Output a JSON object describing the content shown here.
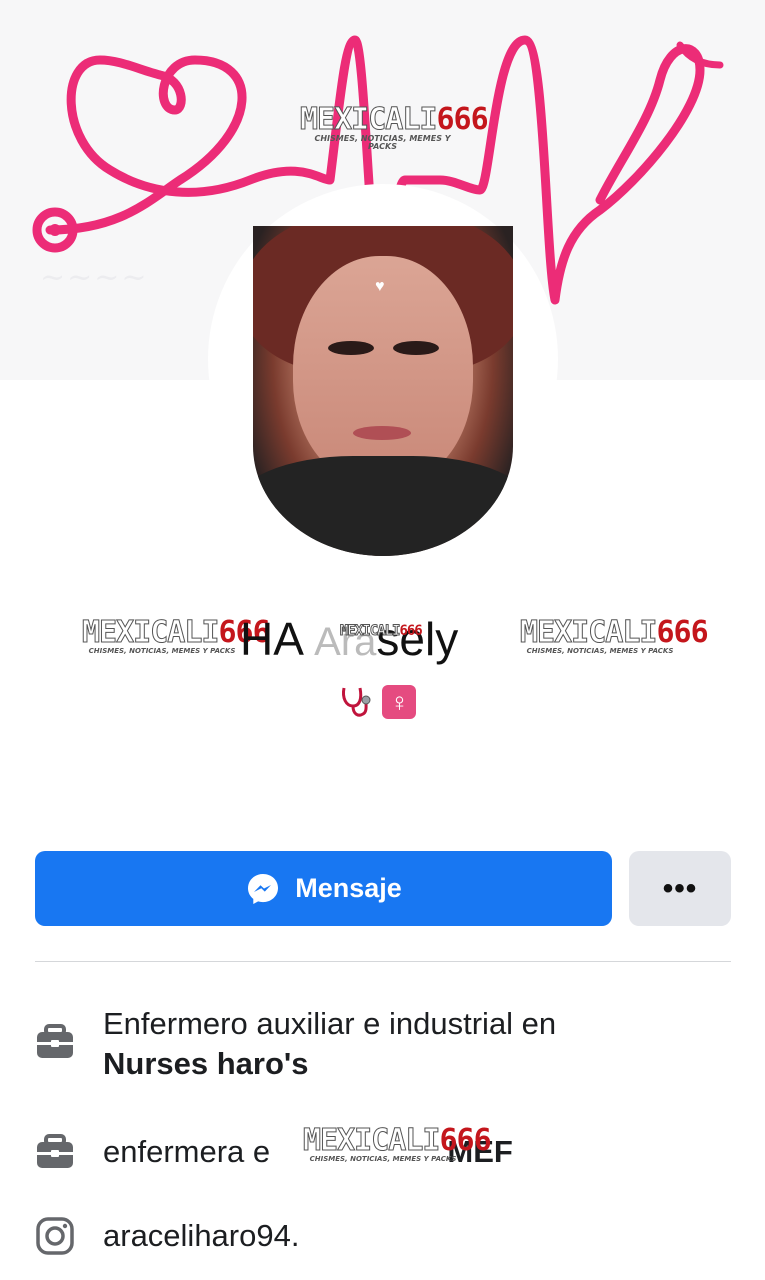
{
  "cover": {
    "watermark_main_a": "MEXICALI",
    "watermark_main_b": "666",
    "watermark_sub": "CHISMES, NOTICIAS, MEMES Y PACKS"
  },
  "profile": {
    "name_visible": "HA Arasely",
    "name_left_fragment": "HA ",
    "name_right_fragment": "sely",
    "name_hidden_fragment": "Ara",
    "emoji_icons": [
      "stethoscope-emoji",
      "female-sign-emoji"
    ],
    "female_sign": "♀"
  },
  "actions": {
    "message_label": "Mensaje",
    "more_label": "•••"
  },
  "info": {
    "work1_prefix": "Enfermero auxiliar e industrial en",
    "work1_place": "Nurses haro's",
    "work2_prefix": "enfermera e",
    "work2_suffix": "MEF",
    "instagram": "araceliharo94."
  },
  "colors": {
    "accent": "#1877f2",
    "ecg_pink": "#ec2c77",
    "watermark_red": "#c4161c"
  }
}
